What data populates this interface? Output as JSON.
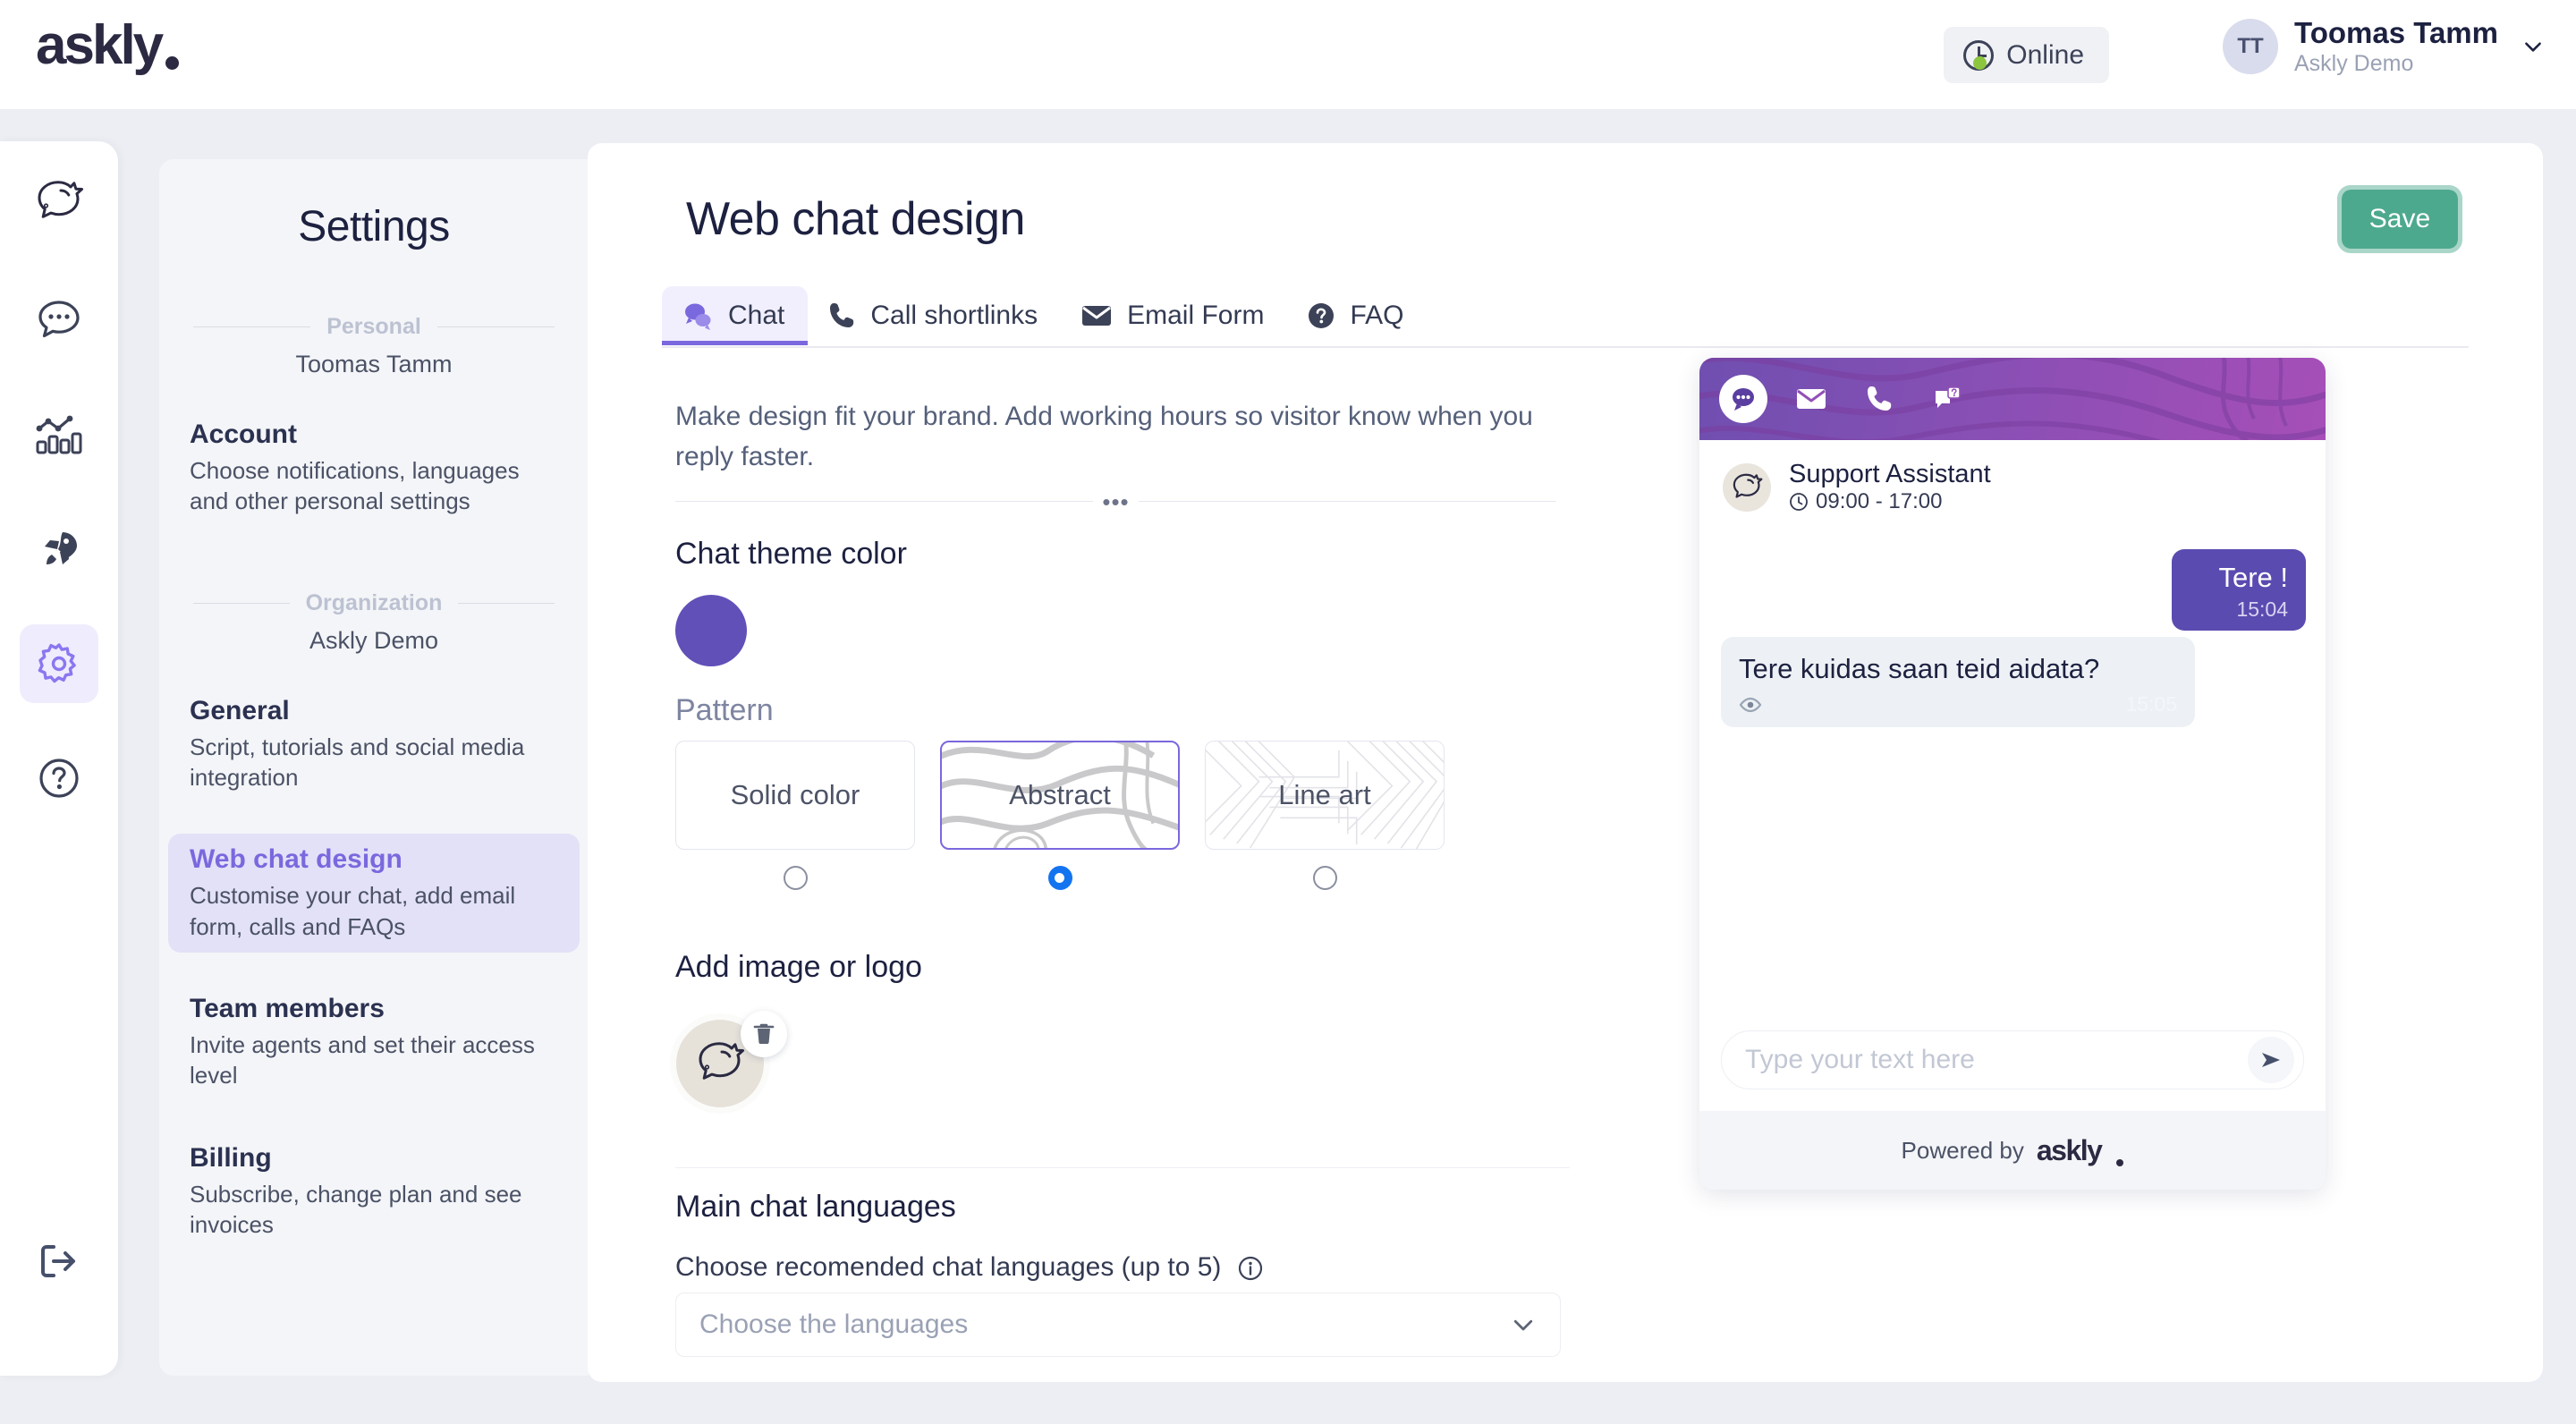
{
  "brand": {
    "name": "askly",
    "trademark": "®",
    "accent_purple": "#7a68de",
    "theme_color": "#6050b8",
    "save_green": "#4da98e"
  },
  "topbar": {
    "status_badge": {
      "label": "Online",
      "icon": "clock-icon",
      "dot_color": "#8cc63f"
    },
    "user": {
      "initials": "TT",
      "name": "Toomas Tamm",
      "org": "Askly Demo"
    }
  },
  "rail": {
    "items": [
      {
        "icon": "askly-mascot-icon",
        "name": "logo"
      },
      {
        "icon": "chat-bubble-icon",
        "name": "conversations"
      },
      {
        "icon": "analytics-chart-icon",
        "name": "analytics"
      },
      {
        "icon": "rocket-icon",
        "name": "campaigns"
      },
      {
        "icon": "gear-icon",
        "name": "settings",
        "active": true
      },
      {
        "icon": "question-circle-icon",
        "name": "help"
      }
    ],
    "logout": {
      "icon": "logout-icon",
      "name": "logout"
    }
  },
  "settings_nav": {
    "title": "Settings",
    "groups": [
      {
        "label": "Personal",
        "subtitle": "Toomas Tamm",
        "items": [
          {
            "title": "Account",
            "desc": "Choose notifications, languages and other personal settings",
            "active": false
          }
        ]
      },
      {
        "label": "Organization",
        "subtitle": "Askly Demo",
        "items": [
          {
            "title": "General",
            "desc": "Script, tutorials and social media integration",
            "active": false
          },
          {
            "title": "Web chat design",
            "desc": "Customise your chat, add email form, calls and FAQs",
            "active": true
          },
          {
            "title": "Team members",
            "desc": "Invite agents and set their access level",
            "active": false
          },
          {
            "title": "Billing",
            "desc": "Subscribe, change plan and see invoices",
            "active": false
          }
        ]
      }
    ]
  },
  "main": {
    "page_title": "Web chat design",
    "save_label": "Save",
    "tabs": [
      {
        "label": "Chat",
        "icon": "chat-bubbles-icon",
        "active": true
      },
      {
        "label": "Call shortlinks",
        "icon": "phone-icon",
        "active": false
      },
      {
        "label": "Email Form",
        "icon": "envelope-icon",
        "active": false
      },
      {
        "label": "FAQ",
        "icon": "question-circle-icon",
        "active": false
      }
    ],
    "description": "Make design fit your brand. Add working hours so visitor know when you reply faster.",
    "divider_dots": "•••",
    "theme_color_label": "Chat theme color",
    "theme_color_value": "#6050b8",
    "pattern_label": "Pattern",
    "patterns": [
      {
        "label": "Solid color",
        "selected": false
      },
      {
        "label": "Abstract",
        "selected": true
      },
      {
        "label": "Line art",
        "selected": false
      }
    ],
    "image_label": "Add image or logo",
    "image_delete_icon": "trash-icon",
    "languages_label": "Main chat languages",
    "languages_help": "Choose recomended chat languages (up to 5)",
    "languages_info_icon": "info-icon",
    "languages_placeholder": "Choose the languages"
  },
  "widget": {
    "header_icons": [
      {
        "icon": "chat-bubbles-icon",
        "active": true
      },
      {
        "icon": "envelope-icon",
        "active": false
      },
      {
        "icon": "phone-icon",
        "active": false
      },
      {
        "icon": "faq-bubble-icon",
        "active": false
      }
    ],
    "agent": {
      "name": "Support Assistant",
      "hours": "09:00 - 17:00",
      "hours_icon": "clock-icon",
      "avatar_icon": "askly-mascot-icon"
    },
    "messages": [
      {
        "side": "out",
        "text": "Tere !",
        "time": "15:04"
      },
      {
        "side": "in",
        "text": "Tere kuidas saan teid aidata?",
        "time": "15:05",
        "icon": "eye-icon"
      }
    ],
    "input_placeholder": "Type your text here",
    "send_icon": "send-icon",
    "footer": {
      "powered_by": "Powered by",
      "brand": "askly"
    }
  }
}
